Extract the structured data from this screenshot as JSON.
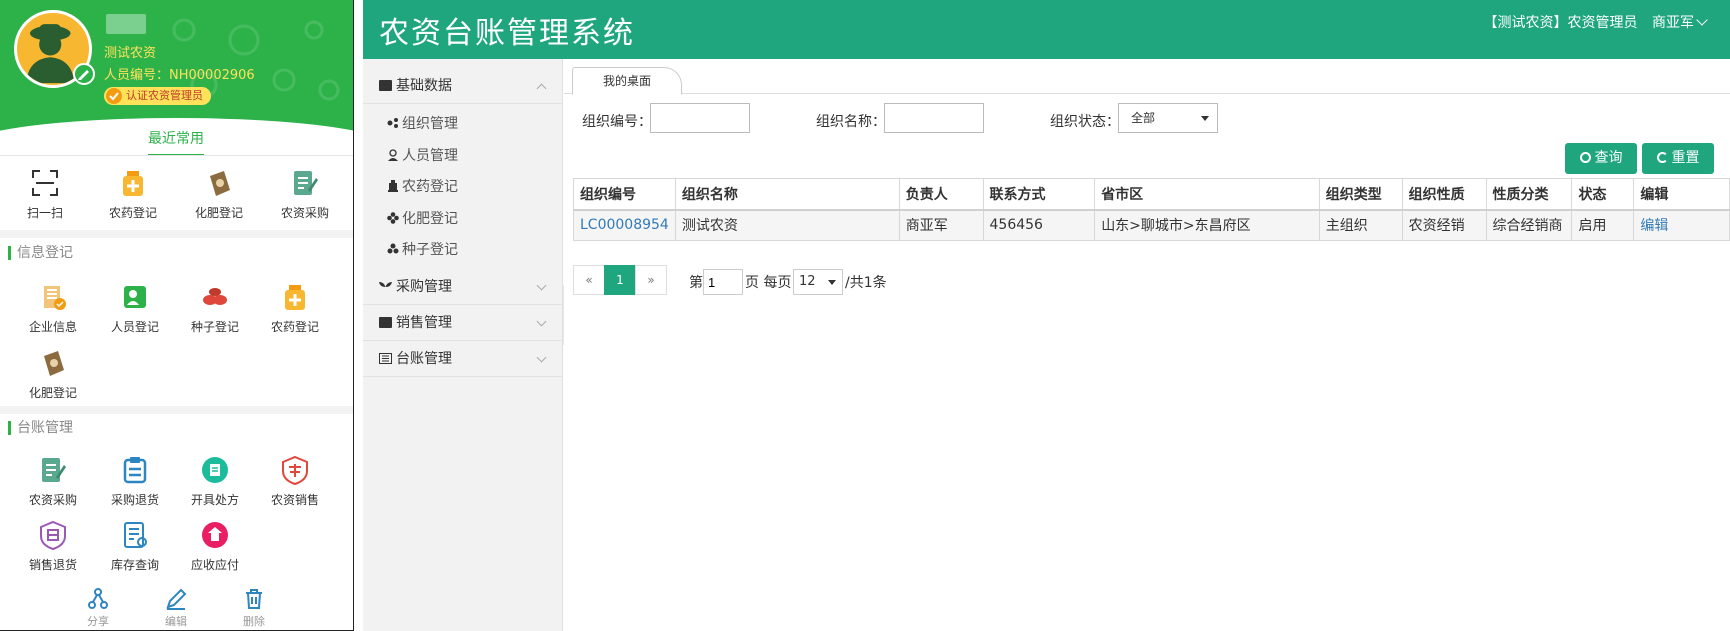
{
  "mobile": {
    "profile": {
      "org_name": "测试农资",
      "staff_no_label": "人员编号：",
      "staff_no": "NH00002906",
      "cert_badge": "认证农资管理员"
    },
    "recent_tab": "最近常用",
    "recent_items": [
      {
        "label": "扫一扫",
        "icon": "scan-icon"
      },
      {
        "label": "农药登记",
        "icon": "pesticide-icon"
      },
      {
        "label": "化肥登记",
        "icon": "fertilizer-icon"
      },
      {
        "label": "农资采购",
        "icon": "purchase-icon"
      }
    ],
    "info_section": "信息登记",
    "info_items": [
      {
        "label": "企业信息",
        "icon": "enterprise-icon"
      },
      {
        "label": "人员登记",
        "icon": "person-icon"
      },
      {
        "label": "种子登记",
        "icon": "seed-icon"
      },
      {
        "label": "农药登记",
        "icon": "pesticide-icon"
      },
      {
        "label": "化肥登记",
        "icon": "fertilizer-icon"
      }
    ],
    "ledger_section": "台账管理",
    "ledger_items": [
      {
        "label": "农资采购",
        "icon": "purchase-icon"
      },
      {
        "label": "采购退货",
        "icon": "return-icon"
      },
      {
        "label": "开具处方",
        "icon": "prescription-icon"
      },
      {
        "label": "农资销售",
        "icon": "sales-icon"
      },
      {
        "label": "销售退货",
        "icon": "sales-return-icon"
      },
      {
        "label": "库存查询",
        "icon": "inventory-icon"
      },
      {
        "label": "应收应付",
        "icon": "receivable-icon"
      }
    ],
    "bottom_actions": [
      {
        "label": "分享",
        "icon": "share-icon"
      },
      {
        "label": "编辑",
        "icon": "edit-icon"
      },
      {
        "label": "删除",
        "icon": "trash-icon"
      }
    ],
    "colors": {
      "brand_green": "#2db24a",
      "accent_yellow": "#ffe25a"
    }
  },
  "web": {
    "title": "农资台账管理系统",
    "user": {
      "org": "【测试农资】农资管理员",
      "name": "商亚军"
    },
    "sidebar": {
      "groups": [
        {
          "label": "基础数据",
          "expanded": true
        },
        {
          "label": "采购管理",
          "expanded": false
        },
        {
          "label": "销售管理",
          "expanded": false
        },
        {
          "label": "台账管理",
          "expanded": false
        }
      ],
      "sub_items": [
        "组织管理",
        "人员管理",
        "农药登记",
        "化肥登记",
        "种子登记"
      ]
    },
    "tab": "我的桌面",
    "filters": {
      "org_no_label": "组织编号：",
      "org_no_value": "",
      "org_name_label": "组织名称：",
      "org_name_value": "",
      "status_label": "组织状态：",
      "status_value": "全部"
    },
    "buttons": {
      "search": "查询",
      "reset": "重置"
    },
    "table": {
      "headers": [
        "组织编号",
        "组织名称",
        "负责人",
        "联系方式",
        "省市区",
        "组织类型",
        "组织性质",
        "性质分类",
        "状态",
        "编辑"
      ],
      "rows": [
        [
          "LC00008954",
          "测试农资",
          "商亚军",
          "456456",
          "山东>聊城市>东昌府区",
          "主组织",
          "农资经销",
          "综合经销商",
          "启用",
          "编辑"
        ]
      ]
    },
    "pager": {
      "prev": "«",
      "current": "1",
      "next": "»",
      "page_prefix": "第",
      "page_input": "1",
      "per_page_label": "页 每页",
      "per_page": "12",
      "total": "/共1条"
    },
    "colors": {
      "brand_teal": "#1fa67f",
      "link_blue": "#337ab7"
    }
  }
}
